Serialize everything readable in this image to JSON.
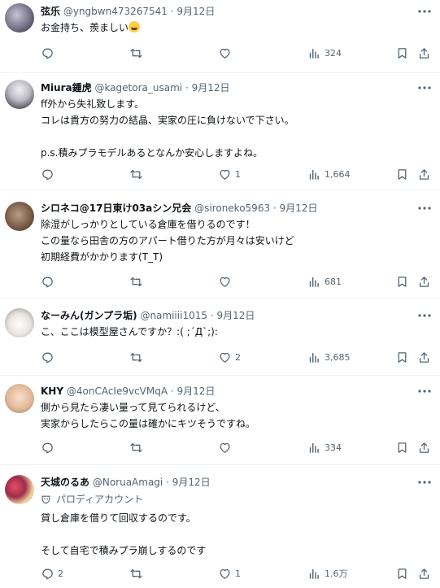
{
  "tweets": [
    {
      "name": "弦乐",
      "handle": "@yngbwn473267541",
      "date": "· 9月12日",
      "lines": [
        "お金持ち、羨ましい"
      ],
      "reply": "",
      "retweet": "",
      "like": "",
      "views": "324",
      "emoji": "face-with-tears-of-joy"
    },
    {
      "name": "Miura鍾虎",
      "handle": "@kagetora_usami",
      "date": "· 9月12日",
      "lines": [
        "ff外から失礼致します。",
        "コレは貴方の努力の結晶、実家の圧に負けないで下さい。",
        "",
        "p.s.積みプラモデルあるとなんか安心しますよね。"
      ],
      "reply": "",
      "retweet": "",
      "like": "1",
      "views": "1,664"
    },
    {
      "name": "シロネコ@17日東け03aシン兄会",
      "handle": "@sironeko5963",
      "date": "· 9月12日",
      "lines": [
        "除湿がしっかりとしている倉庫を借りるのです！",
        "この量なら田舎の方のアパート借りた方が月々は安いけど",
        "初期経費がかかります(T_T)"
      ],
      "reply": "",
      "retweet": "",
      "like": "",
      "views": "681"
    },
    {
      "name": "なーみん(ガンプラ垢)",
      "handle": "@namiiii1015",
      "date": "· 9月12日",
      "lines": [
        "こ、ここは模型屋さんですか？:( ;´Д`;):"
      ],
      "reply": "",
      "retweet": "",
      "like": "2",
      "views": "3,685"
    },
    {
      "name": "KHY",
      "handle": "@4onCAcIe9vcVMqA",
      "date": "· 9月12日",
      "lines": [
        "側から見たら凄い量って見てられるけど、",
        "実家からしたらこの量は確かにキツそうですね。"
      ],
      "reply": "",
      "retweet": "",
      "like": "",
      "views": "334"
    },
    {
      "name": "天城のるあ",
      "handle": "@NoruaAmagi",
      "date": "· 9月12日",
      "badge": "パロディアカウント",
      "lines": [
        "貸し倉庫を借りて回収するのです。",
        "",
        "そして自宅で積みプラ崩しするのです"
      ],
      "reply": "2",
      "retweet": "",
      "like": "1",
      "views": "1.6万"
    }
  ],
  "colors": {
    "text": "#0f1419",
    "secondary": "#536471",
    "divider": "#eff3f4"
  }
}
